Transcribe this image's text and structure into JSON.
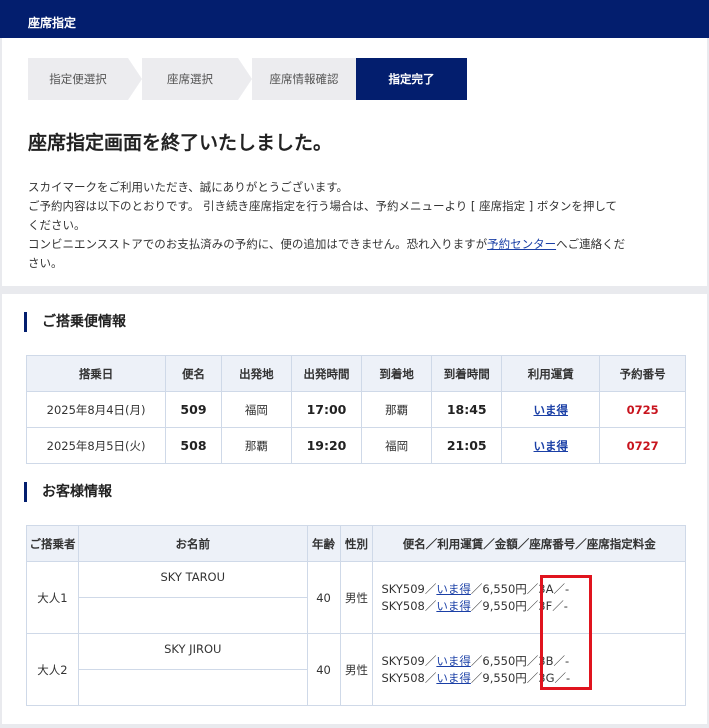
{
  "header": {
    "title": "座席指定"
  },
  "steps": [
    {
      "label": "指定便選択"
    },
    {
      "label": "座席選択"
    },
    {
      "label": "座席情報確認"
    },
    {
      "label": "指定完了"
    }
  ],
  "page_title": "座席指定画面を終了いたしました。",
  "intro": {
    "line1": "スカイマークをご利用いただき、誠にありがとうございます。",
    "line2": "ご予約内容は以下のとおりです。 引き続き座席指定を行う場合は、予約メニューより [ 座席指定 ] ボタンを押して",
    "line3": "ください。",
    "line4_pre": "コンビニエンスストアでのお支払済みの予約に、便の追加はできません。恐れ入りますが",
    "line4_link": "予約センター",
    "line4_post": "へご連絡くだ",
    "line5": "さい。"
  },
  "flight_section": {
    "title": "ご搭乗便情報",
    "headers": [
      "搭乗日",
      "便名",
      "出発地",
      "出発時間",
      "到着地",
      "到着時間",
      "利用運賃",
      "予約番号"
    ],
    "rows": [
      {
        "date": "2025年8月4日(月)",
        "flight": "509",
        "from": "福岡",
        "dep": "17:00",
        "to": "那覇",
        "arr": "18:45",
        "fare": "いま得",
        "resv": "0725"
      },
      {
        "date": "2025年8月5日(火)",
        "flight": "508",
        "from": "那覇",
        "dep": "19:20",
        "to": "福岡",
        "arr": "21:05",
        "fare": "いま得",
        "resv": "0727"
      }
    ]
  },
  "customer_section": {
    "title": "お客様情報",
    "headers": [
      "ご搭乗者",
      "お名前",
      "年齢",
      "性別",
      "便名／利用運賃／金額／座席番号／座席指定料金"
    ],
    "passengers": [
      {
        "type": "大人1",
        "name": "SKY TAROU",
        "age": "40",
        "gender": "男性",
        "lines": [
          {
            "flight": "SKY509／",
            "fare": "いま得",
            "rest": "／6,550円／3A／-"
          },
          {
            "flight": "SKY508／",
            "fare": "いま得",
            "rest": "／9,550円／3F／-"
          }
        ]
      },
      {
        "type": "大人2",
        "name": "SKY JIROU",
        "age": "40",
        "gender": "男性",
        "lines": [
          {
            "flight": "SKY509／",
            "fare": "いま得",
            "rest": "／6,550円／3B／-"
          },
          {
            "flight": "SKY508／",
            "fare": "いま得",
            "rest": "／9,550円／3G／-"
          }
        ]
      }
    ]
  },
  "colors": {
    "brand": "#031e6e",
    "link": "#1a3fa6",
    "reservation": "#c8141e",
    "highlight": "#e0141e"
  }
}
